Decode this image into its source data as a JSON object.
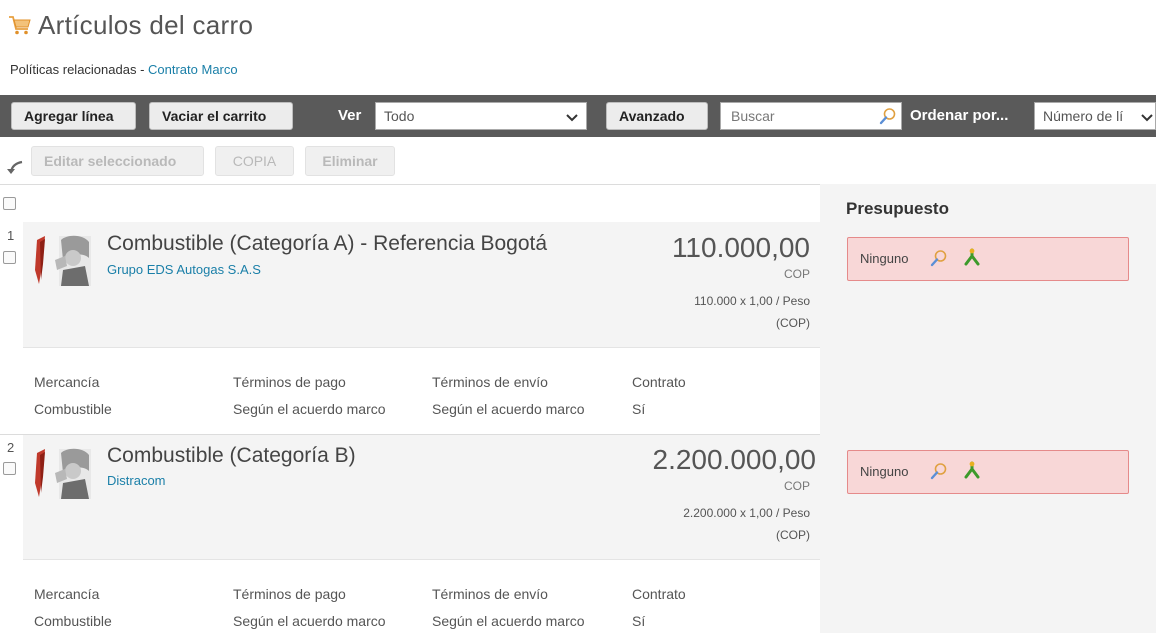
{
  "page": {
    "title": "Artículos del carro",
    "related_label": "Políticas relacionadas - ",
    "related_link": "Contrato Marco"
  },
  "toolbar": {
    "add_line": "Agregar línea",
    "empty_cart": "Vaciar el carrito",
    "view_label": "Ver",
    "view_value": "Todo",
    "advanced": "Avanzado",
    "search_placeholder": "Buscar",
    "sort_label": "Ordenar por...",
    "sort_value": "Número de lí"
  },
  "actions": {
    "edit_selected": "Editar seleccionado",
    "copy": "COPIA",
    "delete": "Eliminar"
  },
  "budget": {
    "title": "Presupuesto",
    "value": "Ninguno"
  },
  "details_headers": {
    "commodity": "Mercancía",
    "payment_terms": "Términos de pago",
    "shipping_terms": "Términos de envío",
    "contract": "Contrato"
  },
  "items": [
    {
      "number": "1",
      "title": "Combustible (Categoría A) - Referencia Bogotá",
      "supplier": "Grupo EDS Autogas S.A.S",
      "price": "110.000,00",
      "currency": "COP",
      "calc_line1": "110.000 x 1,00 / Peso",
      "calc_line2": "(COP)",
      "commodity": "Combustible",
      "payment_terms": "Según el acuerdo marco",
      "shipping_terms": "Según el acuerdo marco",
      "contract": "Sí"
    },
    {
      "number": "2",
      "title": "Combustible (Categoría B)",
      "supplier": "Distracom",
      "price": "2.200.000,00",
      "currency": "COP",
      "calc_line1": "2.200.000 x 1,00 / Peso",
      "calc_line2": "(COP)",
      "commodity": "Combustible",
      "payment_terms": "Según el acuerdo marco",
      "shipping_terms": "Según el acuerdo marco",
      "contract": "Sí"
    }
  ],
  "icons": {
    "cart": "shopping-cart-icon",
    "search": "magnifier-icon",
    "tree": "hierarchy-icon",
    "back": "back-arrow-icon",
    "chevron": "chevron-down-icon",
    "thumbnail": "fuel-attendant-image"
  },
  "colors": {
    "toolbar_bg": "#5a5a5a",
    "link": "#1a7fa8",
    "budget_error_bg": "#f8d7d7",
    "budget_error_border": "#e58a8a"
  }
}
